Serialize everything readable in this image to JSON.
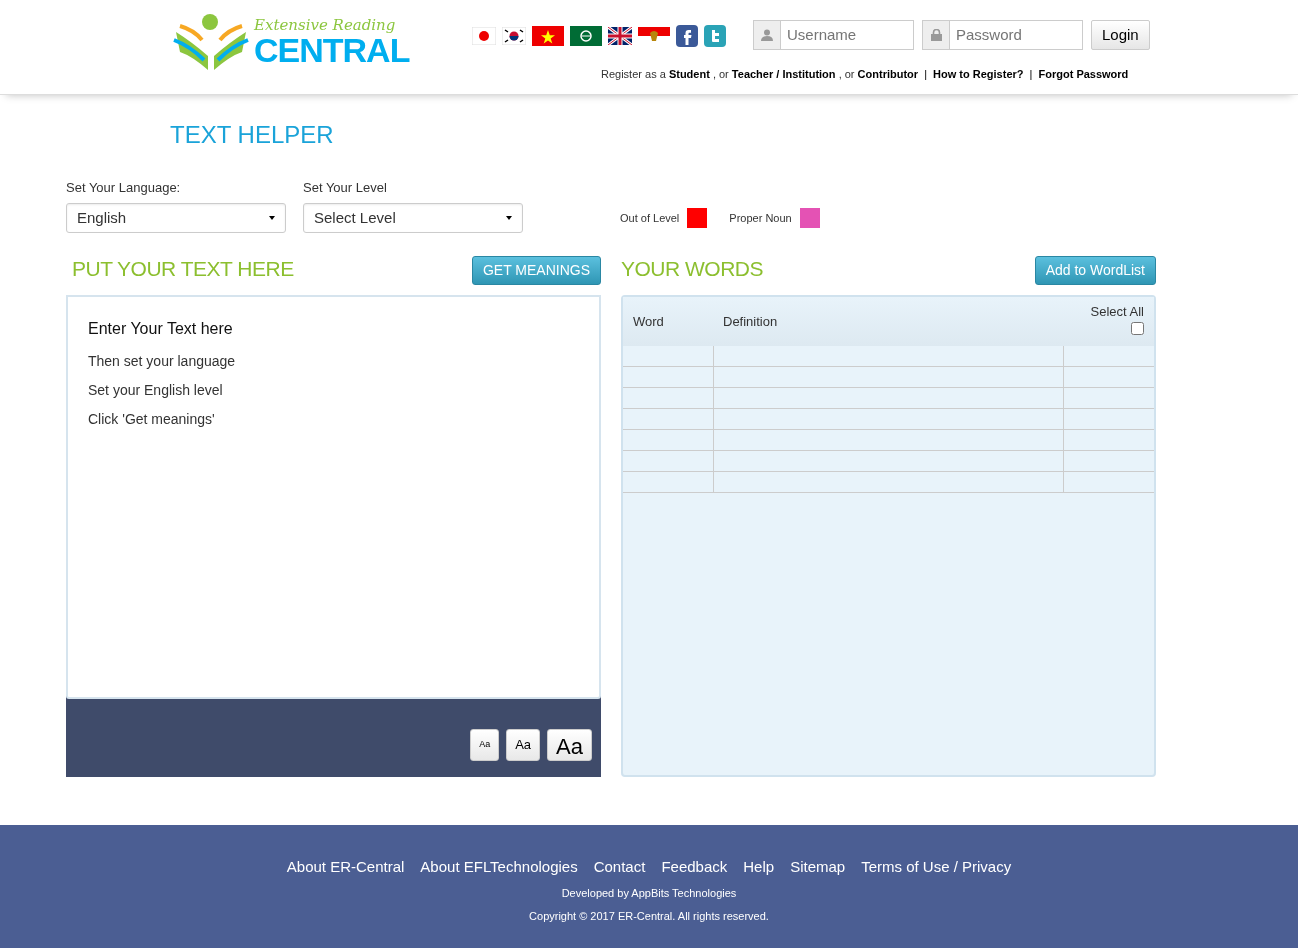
{
  "logo": {
    "script": "Extensive Reading",
    "main": "CENTRAL"
  },
  "flags": [
    {
      "kind": "japan"
    },
    {
      "kind": "korea"
    },
    {
      "kind": "vietnam"
    },
    {
      "kind": "arabic"
    },
    {
      "kind": "uk"
    },
    {
      "kind": "indonesia"
    },
    {
      "kind": "facebook"
    },
    {
      "kind": "twitter"
    }
  ],
  "login": {
    "username_placeholder": "Username",
    "password_placeholder": "Password",
    "button": "Login"
  },
  "register_line": [
    {
      "kind": "text",
      "text": "Register as a"
    },
    {
      "kind": "link",
      "text": "Student"
    },
    {
      "kind": "text",
      "text": ", or"
    },
    {
      "kind": "link",
      "text": "Teacher / Institution"
    },
    {
      "kind": "text",
      "text": ", or"
    },
    {
      "kind": "link",
      "text": "Contributor"
    },
    {
      "kind": "separator",
      "text": "|"
    },
    {
      "kind": "link",
      "text": "How to Register?"
    },
    {
      "kind": "separator",
      "text": "|"
    },
    {
      "kind": "link",
      "text": "Forgot Password"
    }
  ],
  "page_title": "TEXT HELPER",
  "language": {
    "label": "Set Your Language:",
    "value": "English"
  },
  "level": {
    "label": "Set Your Level",
    "value": "Select Level"
  },
  "legend": [
    {
      "label": "Out of Level",
      "color": "#ff0000"
    },
    {
      "label": "Proper Noun",
      "color": "#e452b4"
    }
  ],
  "text_panel": {
    "heading": "PUT YOUR TEXT HERE",
    "button": "GET MEANINGS",
    "editor_title": "Enter Your Text here",
    "editor_lines": [
      "Then set your language",
      "Set your English level",
      "Click 'Get meanings'"
    ],
    "font_buttons": [
      {
        "kind": "small",
        "label": "Aa"
      },
      {
        "kind": "medium",
        "label": "Aa"
      },
      {
        "kind": "large",
        "label": "Aa"
      }
    ]
  },
  "words_panel": {
    "heading": "YOUR WORDS",
    "button": "Add to WordList",
    "columns": [
      "Word",
      "Definition",
      "Select All"
    ],
    "select_all_checked": false
  },
  "footer": {
    "links": [
      "About ER-Central",
      "About EFLTechnologies",
      "Contact",
      "Feedback",
      "Help",
      "Sitemap",
      "Terms of Use / Privacy"
    ],
    "developed": "Developed by AppBits Technologies",
    "copyright": "Copyright © 2017 ER-Central. All rights reserved."
  }
}
